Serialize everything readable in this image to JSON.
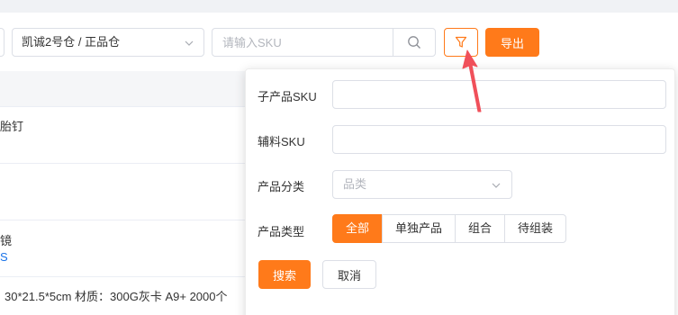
{
  "toolbar": {
    "warehouse_select": "凯诚2号仓 / 正品仓",
    "sku_placeholder": "请输入SKU",
    "export_label": "导出"
  },
  "table": {
    "rows": [
      {
        "text": "胎钉"
      },
      {
        "text": ""
      },
      {
        "text": "镜",
        "link": "S"
      },
      {
        "text": "30*21.5*5cm 材质：300G灰卡 A9+ 2000个"
      }
    ]
  },
  "filter_panel": {
    "sub_sku_label": "子产品SKU",
    "sub_sku_value": "",
    "aux_sku_label": "辅料SKU",
    "aux_sku_value": "",
    "category_label": "产品分类",
    "category_placeholder": "品类",
    "type_label": "产品类型",
    "type_options": [
      "全部",
      "单独产品",
      "组合",
      "待组装"
    ],
    "type_selected": "全部",
    "search_label": "搜索",
    "cancel_label": "取消"
  },
  "colors": {
    "accent": "#ff7a1a",
    "annotation_arrow": "#f0505a",
    "link": "#1a73e8"
  }
}
